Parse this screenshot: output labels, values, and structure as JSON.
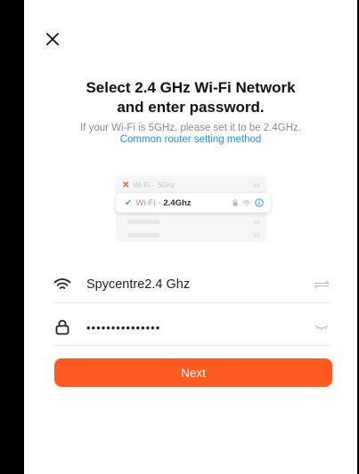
{
  "colors": {
    "accent": "#ff5a1f",
    "link": "#1a8ee6",
    "check": "#3dbb6e",
    "error": "#f0533d"
  },
  "header": {
    "close_icon": "close-icon"
  },
  "title_line1": "Select 2.4 GHz Wi-Fi Network",
  "title_line2": "and enter password.",
  "hint": "If your Wi-Fi is 5GHz, please set it to be 2.4GHz.",
  "router_link": "Common router setting method",
  "illustration": {
    "row_5g": {
      "prefix": "Wi-Fi - ",
      "band": "5Ghz",
      "status_icon": "x-icon"
    },
    "row_24": {
      "prefix": "Wi-Fi - ",
      "band": "2.4Ghz",
      "status_icon": "check-icon",
      "icons": [
        "lock-icon",
        "wifi-icon",
        "info-icon"
      ]
    }
  },
  "network_field": {
    "icon": "wifi-icon",
    "value": "Spycentre2.4 Ghz",
    "trail_icon": "switch-icon"
  },
  "password_field": {
    "icon": "lock-icon",
    "value": "•••••••••••••••",
    "trail_icon": "eye-closed-icon"
  },
  "next_button": {
    "label": "Next"
  }
}
